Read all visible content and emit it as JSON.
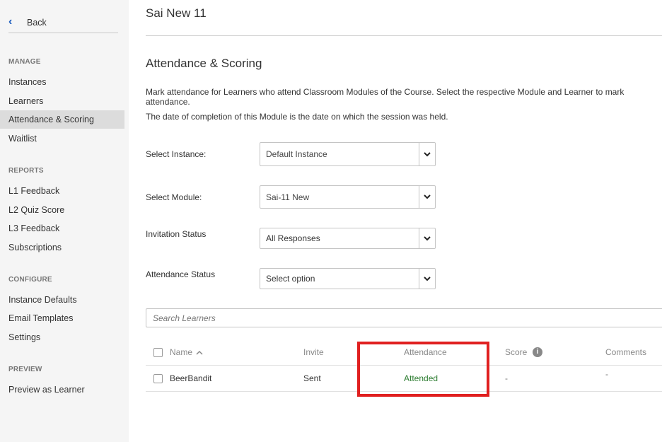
{
  "sidebar": {
    "back_label": "Back",
    "sections": [
      {
        "heading": "MANAGE",
        "items": [
          "Instances",
          "Learners",
          "Attendance & Scoring",
          "Waitlist"
        ]
      },
      {
        "heading": "REPORTS",
        "items": [
          "L1 Feedback",
          "L2 Quiz Score",
          "L3 Feedback",
          "Subscriptions"
        ]
      },
      {
        "heading": "CONFIGURE",
        "items": [
          "Instance Defaults",
          "Email Templates",
          "Settings"
        ]
      },
      {
        "heading": "PREVIEW",
        "items": [
          "Preview as Learner"
        ]
      }
    ],
    "active_item": "Attendance & Scoring"
  },
  "main": {
    "course_title": "Sai New 11",
    "page_title": "Attendance & Scoring",
    "description_1": "Mark attendance for Learners who attend Classroom Modules of the Course. Select the respective Module and Learner to mark attendance.",
    "description_2": "The date of completion of this Module is the date on which the session was held.",
    "filters": {
      "instance": {
        "label": "Select Instance:",
        "value": "Default Instance"
      },
      "module": {
        "label": "Select Module:",
        "value": "Sai-11 New"
      },
      "invitation": {
        "label": "Invitation Status",
        "value": "All Responses"
      },
      "attendance": {
        "label": "Attendance Status",
        "value": "Select option"
      }
    },
    "search_placeholder": "Search Learners",
    "table": {
      "headers": {
        "name": "Name",
        "invite": "Invite",
        "attendance": "Attendance",
        "score": "Score",
        "comments": "Comments"
      },
      "rows": [
        {
          "name": "BeerBandit",
          "invite": "Sent",
          "attendance": "Attended",
          "score": "-",
          "comments": "-"
        }
      ]
    }
  },
  "colors": {
    "accent": "#1f5fbf",
    "attended": "#2e7d32",
    "highlight": "#e02020",
    "sidebar_bg": "#f5f5f5"
  }
}
